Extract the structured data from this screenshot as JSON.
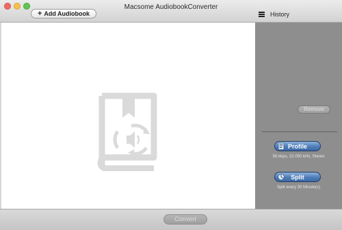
{
  "window": {
    "title": "Macsome AudiobookConverter"
  },
  "toolbar": {
    "add_label": "Add Audiobook",
    "history_label": "History"
  },
  "sidebar": {
    "remove_label": "Remove",
    "profile_label": "Profile",
    "profile_info": "56 kbps, 22.050 kHz, Stereo",
    "split_label": "Split",
    "split_info": "Split every 30 Minute(s)"
  },
  "footer": {
    "convert_label": "Convert"
  },
  "icons": {
    "add": "plus-icon",
    "history": "list-icon",
    "placeholder": "audiobook-icon",
    "profile": "profile-icon",
    "split": "split-icon"
  },
  "colors": {
    "sidebar": "#8e8e8e",
    "accent": "#4f7db8"
  }
}
